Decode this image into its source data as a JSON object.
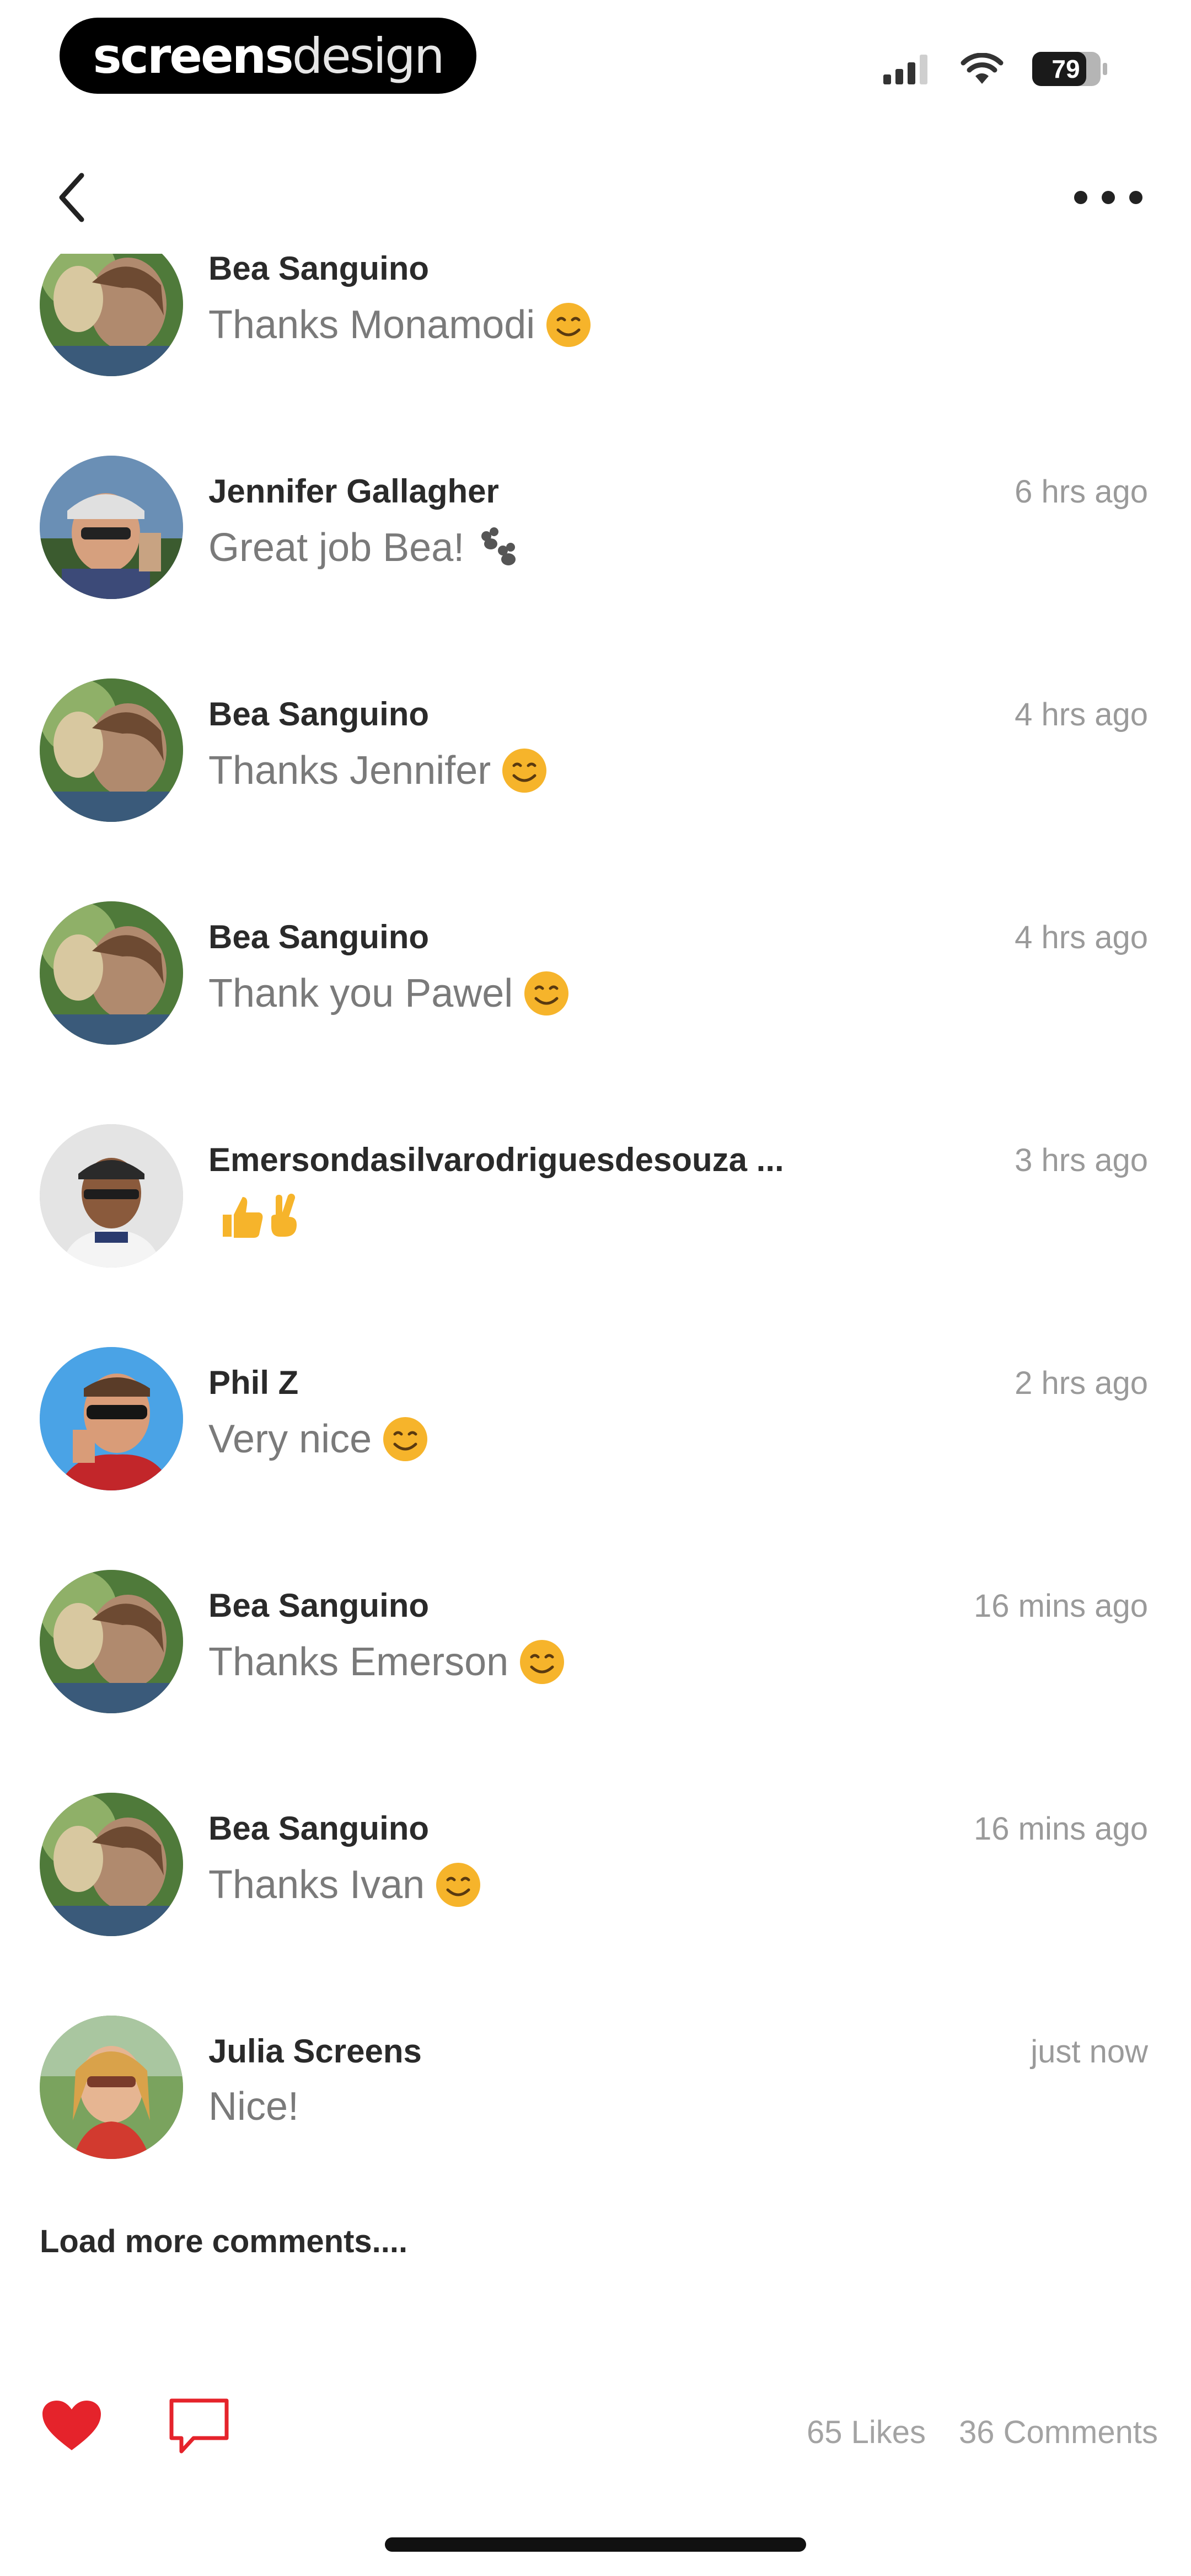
{
  "status_bar": {
    "brand_bold": "screens",
    "brand_light": "design",
    "battery_level": "79",
    "icons": [
      "signal-icon",
      "wifi-icon",
      "battery-icon"
    ]
  },
  "nav": {
    "back_icon": "chevron-left-icon",
    "more_icon": "more-horizontal-icon"
  },
  "comments": [
    {
      "author": "Bea Sanguino",
      "text": "Thanks Monamodi",
      "emoji": "smile",
      "time": "",
      "avatar": "bea"
    },
    {
      "author": "Jennifer Gallagher",
      "text": "Great job Bea!",
      "emoji": "paws",
      "time": "6 hrs ago",
      "avatar": "jennifer"
    },
    {
      "author": "Bea Sanguino",
      "text": "Thanks Jennifer",
      "emoji": "smile",
      "time": "4 hrs ago",
      "avatar": "bea"
    },
    {
      "author": "Bea Sanguino",
      "text": "Thank you Pawel",
      "emoji": "smile",
      "time": "4 hrs ago",
      "avatar": "bea"
    },
    {
      "author": "Emersondasilvarodriguesdesouza ...",
      "text": "",
      "emoji": "thumbs-victory",
      "time": "3 hrs ago",
      "avatar": "emerson"
    },
    {
      "author": "Phil Z",
      "text": "Very nice",
      "emoji": "smile",
      "time": "2 hrs ago",
      "avatar": "phil"
    },
    {
      "author": "Bea Sanguino",
      "text": "Thanks Emerson",
      "emoji": "smile",
      "time": "16 mins ago",
      "avatar": "bea"
    },
    {
      "author": "Bea Sanguino",
      "text": "Thanks Ivan",
      "emoji": "smile",
      "time": "16 mins ago",
      "avatar": "bea"
    },
    {
      "author": "Julia Screens",
      "text": "Nice!",
      "emoji": "",
      "time": "just now",
      "avatar": "julia"
    }
  ],
  "load_more_label": "Load more comments....",
  "actions": {
    "like_icon": "heart-icon",
    "comment_icon": "comment-icon",
    "likes_label": "65 Likes",
    "comments_label": "36 Comments"
  },
  "colors": {
    "accent": "#e5232b",
    "text_primary": "#2a2a2a",
    "text_secondary": "#7a7a7a",
    "timestamp": "#9a9a9a"
  }
}
